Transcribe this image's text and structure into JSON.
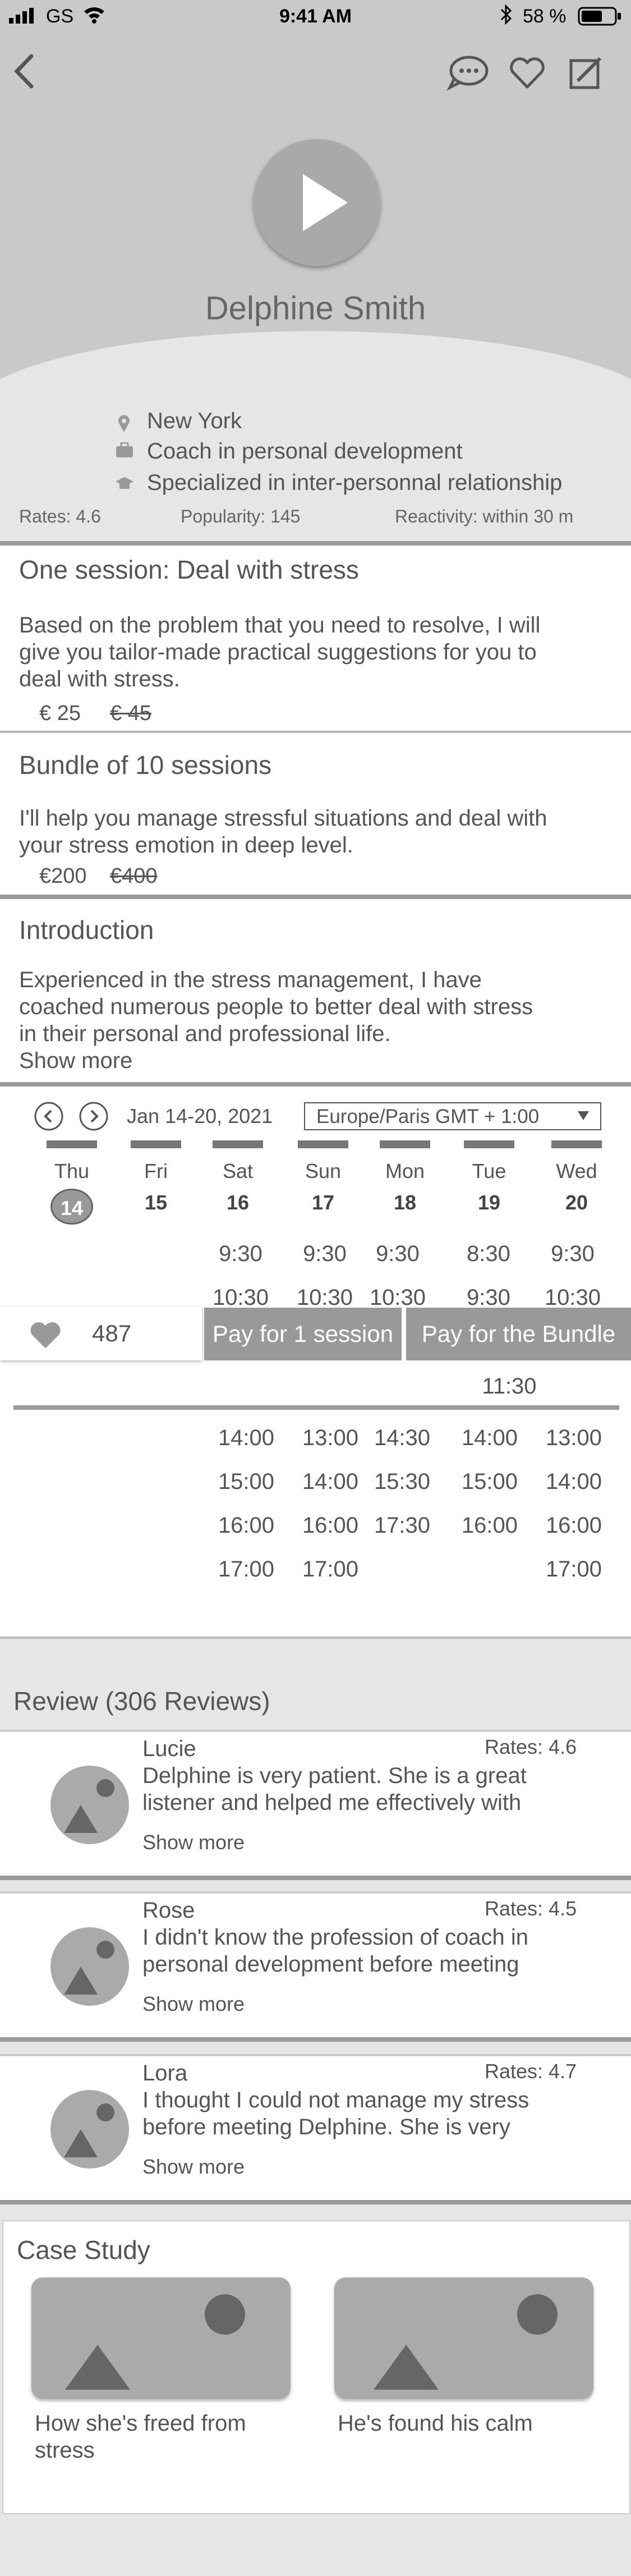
{
  "status": {
    "carrier": "GS",
    "time": "9:41 AM",
    "battery": "58 %"
  },
  "profile": {
    "name": "Delphine Smith",
    "location": "New York",
    "job": "Coach in personal development",
    "specialty": "Specialized in inter-personnal relationship",
    "rates": "Rates: 4.6",
    "popularity": "Popularity: 145",
    "reactivity": "Reactivity: within 30 m"
  },
  "offers": [
    {
      "title": "One session: Deal with stress",
      "desc_l1": "Based on the problem that you need to resolve, I will",
      "desc_l2": "give you tailor-made practical suggestions for you to",
      "desc_l3": "deal with stress.",
      "price": "€ 25",
      "old_price": "€ 45"
    },
    {
      "title": "Bundle of 10 sessions",
      "desc_l1": "I'll help you manage stressful situations and deal with",
      "desc_l2": "your stress emotion in deep level.",
      "price": "€200",
      "old_price": "€400"
    }
  ],
  "intro": {
    "title": "Introduction",
    "l1": "Experienced in the stress management, I have",
    "l2": "coached numerous people to better deal with stress",
    "l3": "in their personal and professional life.",
    "show_more": "Show more"
  },
  "calendar": {
    "range": "Jan 14-20, 2021",
    "timezone": "Europe/Paris GMT + 1:00",
    "days": [
      {
        "name": "Thu",
        "num": "14"
      },
      {
        "name": "Fri",
        "num": "15"
      },
      {
        "name": "Sat",
        "num": "16"
      },
      {
        "name": "Sun",
        "num": "17"
      },
      {
        "name": "Mon",
        "num": "18"
      },
      {
        "name": "Tue",
        "num": "19"
      },
      {
        "name": "Wed",
        "num": "20"
      }
    ],
    "slots_row1": [
      "9:30",
      "9:30",
      "9:30",
      "8:30",
      "9:30"
    ],
    "slots_row2": [
      "10:30",
      "10:30",
      "10:30",
      "9:30",
      "10:30"
    ],
    "lower_single": "11:30",
    "lower_rows": [
      [
        "14:00",
        "13:00",
        "14:30",
        "14:00",
        "13:00"
      ],
      [
        "15:00",
        "14:00",
        "15:30",
        "15:00",
        "14:00"
      ],
      [
        "16:00",
        "16:00",
        "17:30",
        "16:00",
        "16:00"
      ],
      [
        "17:00",
        "17:00",
        "",
        "",
        "17:00"
      ]
    ]
  },
  "actions": {
    "likes": "487",
    "pay_one": "Pay for 1 session",
    "pay_bundle": "Pay for the Bundle"
  },
  "reviews": {
    "title": "Review (306 Reviews)",
    "items": [
      {
        "name": "Lucie",
        "rate": "Rates: 4.6",
        "l1": "Delphine is very patient. She is a great",
        "l2": "listener and helped me effectively with",
        "more": "Show more"
      },
      {
        "name": "Rose",
        "rate": "Rates: 4.5",
        "l1": "I didn't know the profession of coach in",
        "l2": "personal development before meeting",
        "more": "Show more"
      },
      {
        "name": "Lora",
        "rate": "Rates: 4.7",
        "l1": "I thought I could not manage my stress",
        "l2": "before meeting Delphine. She is very",
        "more": "Show more"
      }
    ]
  },
  "case_study": {
    "title": "Case Study",
    "items": [
      {
        "l1": "How she's freed from",
        "l2": "stress"
      },
      {
        "l1": "He's found his calm",
        "l2": ""
      }
    ]
  },
  "colors": {
    "hero_bg": "#c9c9c9",
    "button_gray": "#999999",
    "divider": "#9a9a9a"
  }
}
